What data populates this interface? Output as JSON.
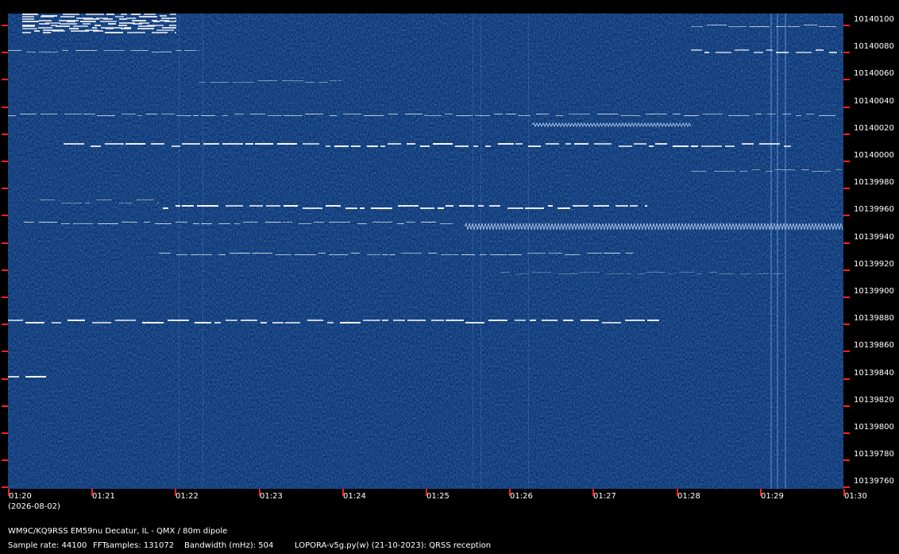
{
  "station_info": "WM9C/KQ9RSS EM59nu Decatur, IL - QMX / 80m dipole",
  "date": "(2026-08-02)",
  "sample_rate": "Sample rate: 44100",
  "fft_samples": "FFTsamples: 131072",
  "bandwidth": "Bandwidth (mHz): 504",
  "software": "LOPORA-v5g.py(w) (21-10-2023): QRSS reception",
  "time_axis": {
    "labels": [
      "01:20",
      "01:21",
      "01:22",
      "01:23",
      "01:24",
      "01:25",
      "01:26",
      "01:27",
      "01:28",
      "01:29",
      "01:30"
    ]
  },
  "frequency_axis": {
    "unit": "Hz",
    "labels": [
      "10140100",
      "10140080",
      "10140060",
      "10140040",
      "10140020",
      "10140000",
      "10139980",
      "10139960",
      "10139940",
      "10139920",
      "10139900",
      "10139880",
      "10139860",
      "10139840",
      "10139820",
      "10139800",
      "10139780",
      "10139760"
    ]
  },
  "colors": {
    "background": "#000000",
    "spectrogram_bg": "#0d3a76",
    "signal": "#ffffff",
    "tick": "#ff2020",
    "text": "#ffffff"
  }
}
